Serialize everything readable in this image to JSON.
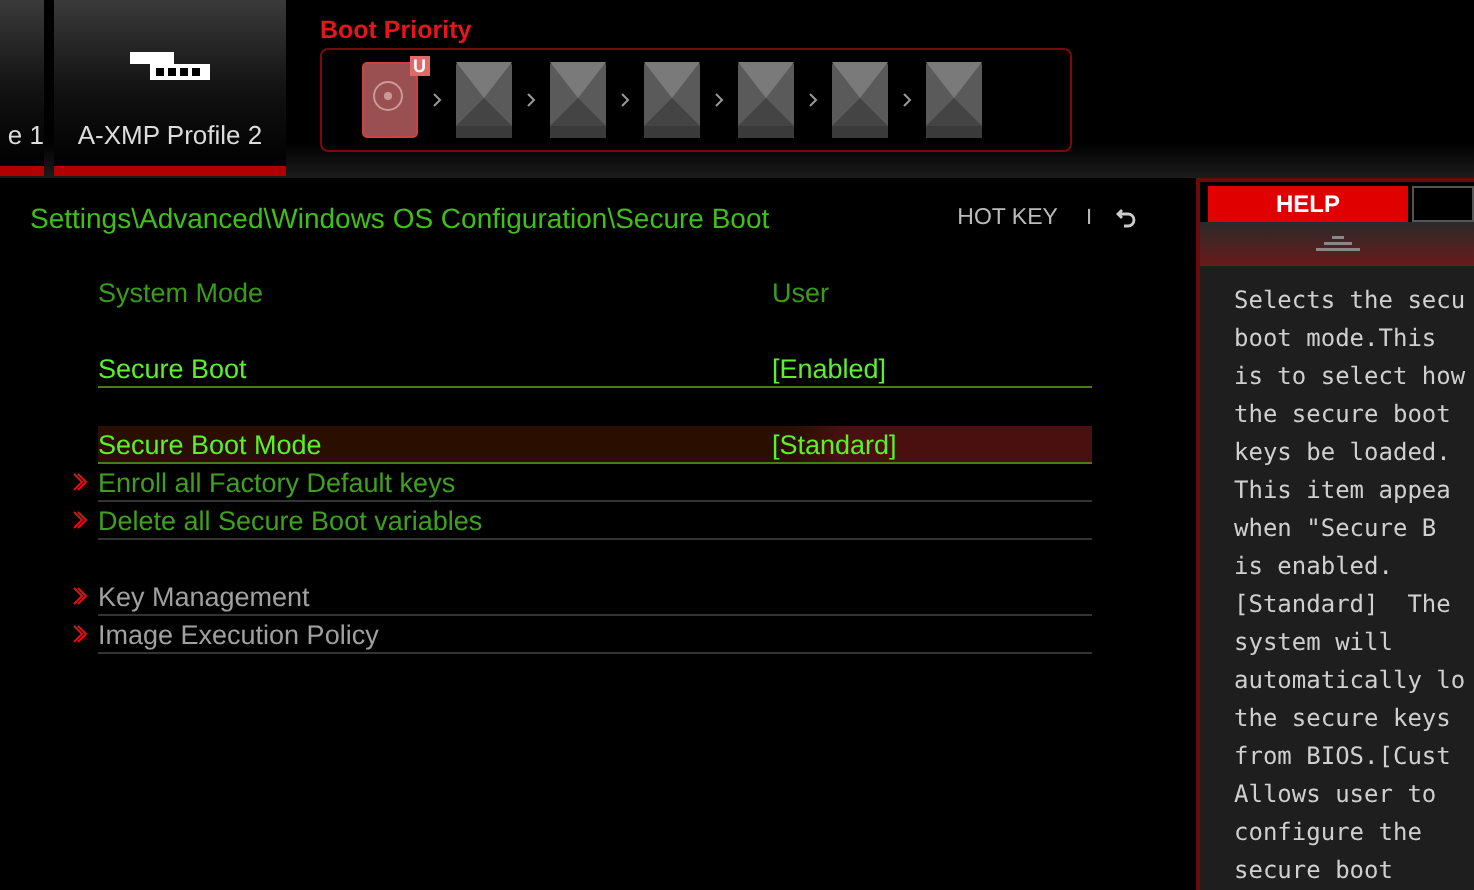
{
  "top_tabs": [
    {
      "label": "e 1",
      "selected": false
    },
    {
      "label": "A-XMP Profile 2",
      "selected": true
    }
  ],
  "boot_priority": {
    "title": "Boot Priority",
    "devices": [
      {
        "kind": "hdd",
        "badge": "U"
      },
      {
        "kind": "empty"
      },
      {
        "kind": "empty"
      },
      {
        "kind": "empty"
      },
      {
        "kind": "empty"
      },
      {
        "kind": "empty"
      },
      {
        "kind": "empty"
      }
    ]
  },
  "breadcrumb": "Settings\\Advanced\\Windows OS Configuration\\Secure Boot",
  "hotkey": {
    "label": "HOT KEY",
    "separator": "I"
  },
  "groups": [
    [
      {
        "kind": "info",
        "label": "System Mode",
        "value": "User",
        "selected": false
      }
    ],
    [
      {
        "kind": "option",
        "label": "Secure Boot",
        "value": "[Enabled]",
        "selected": false
      }
    ],
    [
      {
        "kind": "option",
        "label": "Secure Boot Mode",
        "value": "[Standard]",
        "selected": true
      },
      {
        "kind": "action",
        "label": "Enroll all Factory Default keys",
        "selected": false
      },
      {
        "kind": "action",
        "label": "Delete all Secure Boot variables",
        "selected": false
      }
    ],
    [
      {
        "kind": "submenu",
        "label": "Key Management",
        "selected": false
      },
      {
        "kind": "submenu",
        "label": "Image Execution Policy",
        "selected": false
      }
    ]
  ],
  "help": {
    "tab": "HELP",
    "lines": [
      "Selects the secu",
      "boot mode.This",
      "is to select how",
      "the secure boot",
      "keys be loaded.",
      "This item appea",
      "when \"Secure B",
      "is enabled.",
      "[Standard]  The",
      "system will",
      "automatically lo",
      "the secure keys",
      "from BIOS.[Cust",
      "Allows user to",
      "configure the",
      "secure boot"
    ]
  }
}
